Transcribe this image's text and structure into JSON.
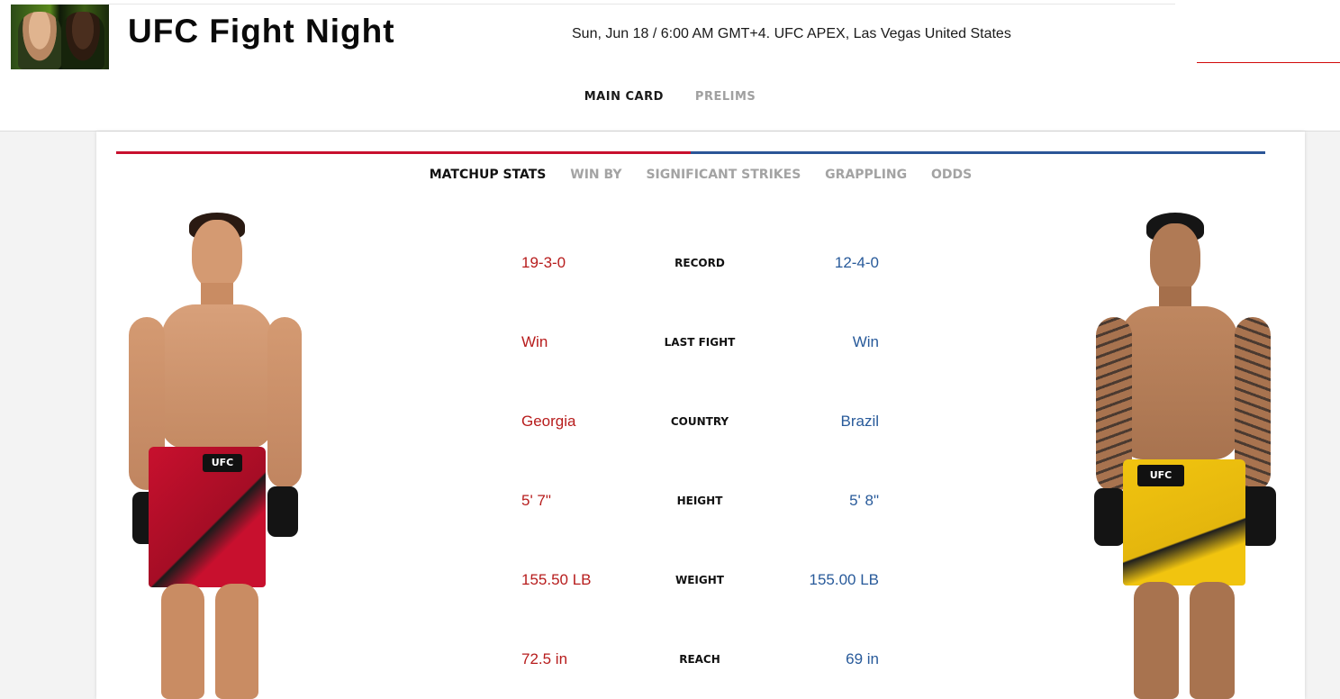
{
  "event": {
    "title": "UFC Fight Night",
    "meta": "Sun, Jun 18 / 6:00 AM GMT+4. UFC APEX, Las Vegas United States"
  },
  "card_tabs": [
    {
      "label": "MAIN CARD",
      "active": true
    },
    {
      "label": "PRELIMS",
      "active": false
    }
  ],
  "stat_tabs": [
    {
      "label": "MATCHUP STATS",
      "active": true
    },
    {
      "label": "WIN BY",
      "active": false
    },
    {
      "label": "SIGNIFICANT STRIKES",
      "active": false
    },
    {
      "label": "GRAPPLING",
      "active": false
    },
    {
      "label": "ODDS",
      "active": false
    }
  ],
  "stats": [
    {
      "label": "RECORD",
      "red": "19-3-0",
      "blue": "12-4-0"
    },
    {
      "label": "LAST FIGHT",
      "red": "Win",
      "blue": "Win"
    },
    {
      "label": "COUNTRY",
      "red": "Georgia",
      "blue": "Brazil"
    },
    {
      "label": "HEIGHT",
      "red": "5' 7\"",
      "blue": "5' 8\""
    },
    {
      "label": "WEIGHT",
      "red": "155.50 LB",
      "blue": "155.00 LB"
    },
    {
      "label": "REACH",
      "red": "72.5 in",
      "blue": "69 in"
    }
  ],
  "fighters": {
    "red_shorts_text": "UFC",
    "blue_shorts_text": "UFC"
  },
  "colors": {
    "red_corner": "#c8102e",
    "blue_corner": "#2b5597",
    "red_value": "#b71c1c",
    "blue_value": "#285a9a"
  }
}
